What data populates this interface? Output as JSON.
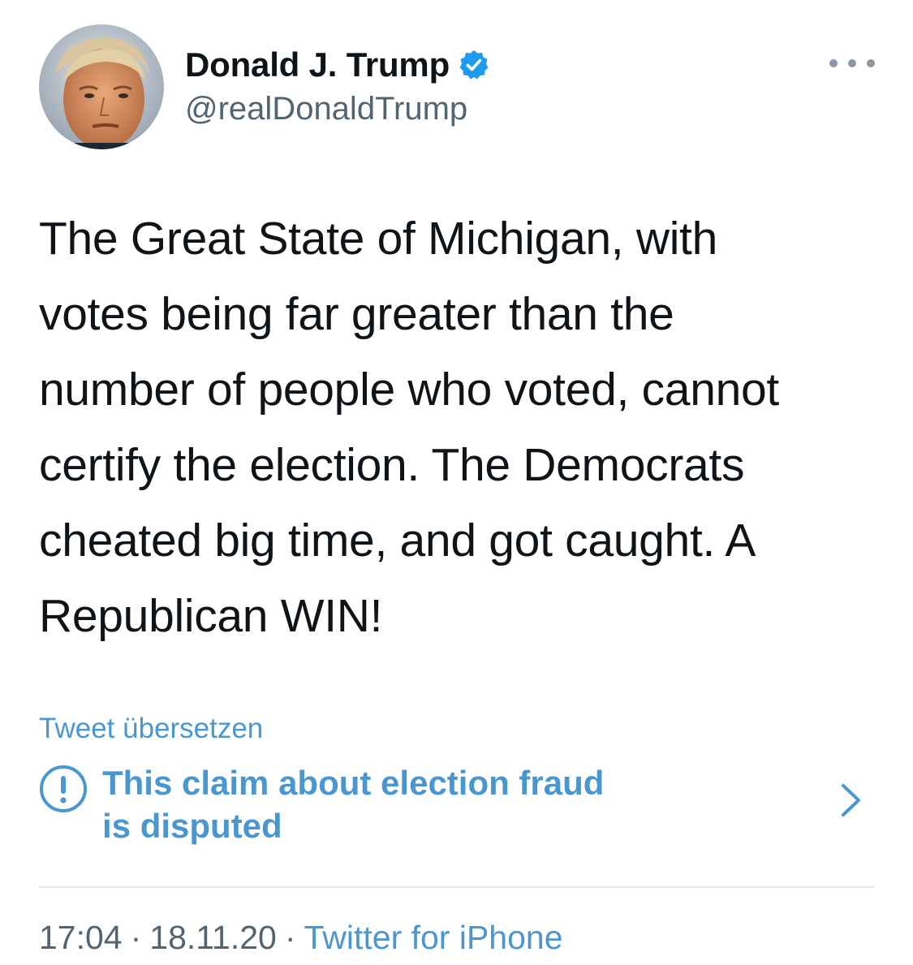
{
  "author": {
    "display_name": "Donald J. Trump",
    "handle": "@realDonaldTrump",
    "verified": true,
    "avatar_icon": "profile-photo"
  },
  "tweet": {
    "lines": [
      "The Great State of Michigan, with",
      "votes being far greater than the",
      "number of people who voted, cannot",
      "certify the election. The Democrats",
      "cheated big time, and got caught. A",
      "Republican WIN!"
    ]
  },
  "translate_label": "Tweet übersetzen",
  "notice": {
    "icon": "exclamation-circle-icon",
    "line1": "This claim about election fraud",
    "line2": "is disputed"
  },
  "meta": {
    "time": "17:04",
    "separator": "·",
    "date": "18.11.20",
    "source": "Twitter for iPhone"
  },
  "colors": {
    "link_blue": "#4a97d0",
    "verified_blue": "#1d9bf0",
    "secondary_text": "#536471",
    "primary_text": "#0f1419"
  }
}
